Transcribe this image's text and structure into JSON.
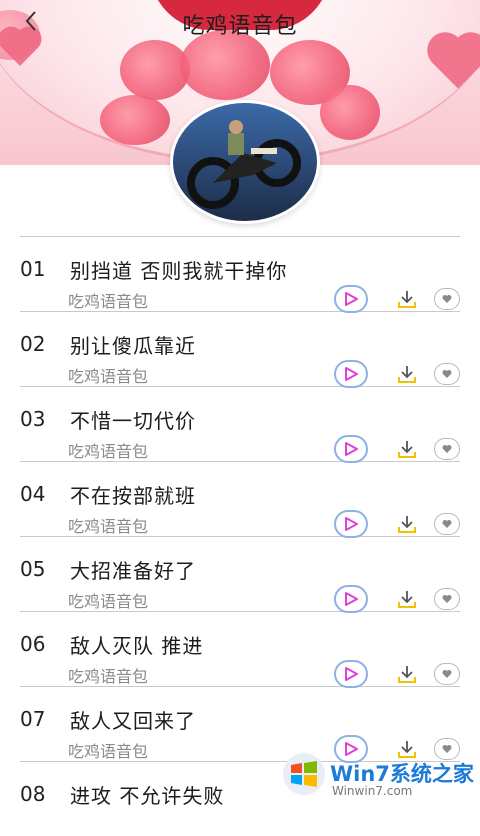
{
  "header": {
    "title": "吃鸡语音包",
    "back_icon": "chevron-left-icon"
  },
  "items": [
    {
      "num": "01",
      "name": "别挡道 否则我就干掉你",
      "sub": "吃鸡语音包"
    },
    {
      "num": "02",
      "name": "别让傻瓜靠近",
      "sub": "吃鸡语音包"
    },
    {
      "num": "03",
      "name": "不惜一切代价",
      "sub": "吃鸡语音包"
    },
    {
      "num": "04",
      "name": "不在按部就班",
      "sub": "吃鸡语音包"
    },
    {
      "num": "05",
      "name": "大招准备好了",
      "sub": "吃鸡语音包"
    },
    {
      "num": "06",
      "name": "敌人灭队 推进",
      "sub": "吃鸡语音包"
    },
    {
      "num": "07",
      "name": "敌人又回来了",
      "sub": "吃鸡语音包"
    },
    {
      "num": "08",
      "name": "进攻 不允许失败",
      "sub": ""
    }
  ],
  "colors": {
    "play_icon": "#e040d8",
    "play_border": "#8fb0e6",
    "download_icon": "#f2c200",
    "watermark": "#1b7bd6"
  },
  "watermark": {
    "text": "Win7系统之家",
    "url": "Winwin7.com"
  }
}
